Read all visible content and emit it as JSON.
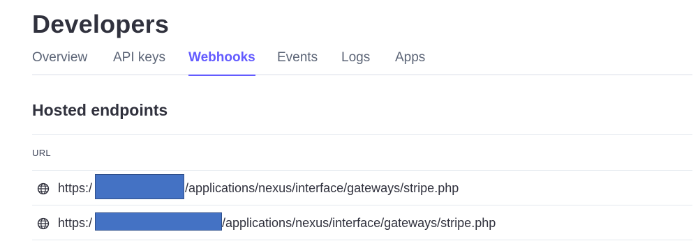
{
  "header": {
    "title": "Developers"
  },
  "tabs": [
    {
      "label": "Overview",
      "active": false
    },
    {
      "label": "API keys",
      "active": false
    },
    {
      "label": "Webhooks",
      "active": true
    },
    {
      "label": "Events",
      "active": false
    },
    {
      "label": "Logs",
      "active": false
    },
    {
      "label": "Apps",
      "active": false
    }
  ],
  "section": {
    "title": "Hosted endpoints"
  },
  "table": {
    "columns": [
      "URL"
    ],
    "rows": [
      {
        "url_prefix": "https:/",
        "url_suffix": "/applications/nexus/interface/gateways/stripe.php",
        "icon": "globe-icon"
      },
      {
        "url_prefix": "https:/",
        "url_suffix": "/applications/nexus/interface/gateways/stripe.php",
        "icon": "globe-icon"
      }
    ]
  },
  "colors": {
    "accent": "#635bff",
    "redaction": "#4472c4"
  }
}
